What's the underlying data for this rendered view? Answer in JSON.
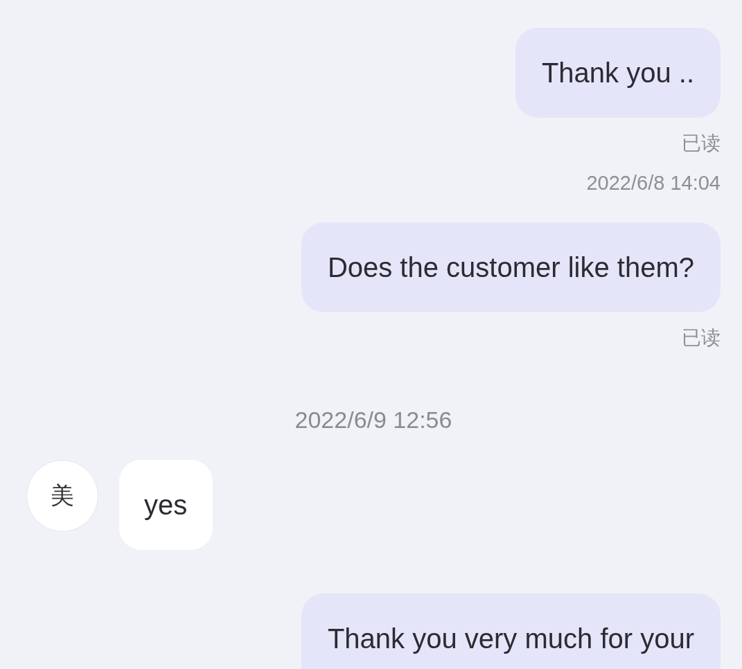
{
  "messages": [
    {
      "kind": "outgoing",
      "text": "Thank you ..",
      "status": "已读",
      "time": "2022/6/8 14:04"
    },
    {
      "kind": "outgoing",
      "text": "Does the customer like them?",
      "status": "已读"
    },
    {
      "kind": "timestamp",
      "text": "2022/6/9 12:56"
    },
    {
      "kind": "incoming",
      "avatar": "美",
      "text": "yes"
    },
    {
      "kind": "outgoing",
      "text": "Thank you very much for your"
    }
  ]
}
